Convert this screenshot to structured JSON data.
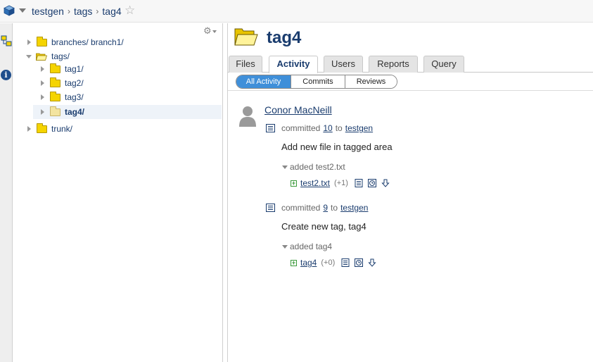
{
  "breadcrumb": {
    "items": [
      "testgen",
      "tags",
      "tag4"
    ],
    "separator": "›"
  },
  "tree": {
    "nodes": [
      {
        "label": "branches/ branch1/",
        "expanded": false
      },
      {
        "label": "tags/",
        "expanded": true
      },
      {
        "label": "tag1/",
        "expanded": false
      },
      {
        "label": "tag2/",
        "expanded": false
      },
      {
        "label": "tag3/",
        "expanded": false
      },
      {
        "label": "tag4/",
        "expanded": false,
        "selected": true
      },
      {
        "label": "trunk/",
        "expanded": false
      }
    ]
  },
  "main": {
    "title": "tag4",
    "tabs": [
      {
        "label": "Files",
        "active": false
      },
      {
        "label": "Activity",
        "active": true
      },
      {
        "label": "Users",
        "active": false
      },
      {
        "label": "Reports",
        "active": false
      },
      {
        "label": "Query",
        "active": false
      }
    ],
    "subtabs": [
      {
        "label": "All Activity",
        "active": true
      },
      {
        "label": "Commits",
        "active": false
      },
      {
        "label": "Reviews",
        "active": false
      }
    ],
    "activity": {
      "author": "Conor MacNeill",
      "commits": [
        {
          "verb": "committed",
          "revision": "10",
          "to": "to",
          "repo": "testgen",
          "message": "Add new file in tagged area",
          "added_label": "added test2.txt",
          "file": {
            "name": "test2.txt",
            "delta": "(+1)"
          }
        },
        {
          "verb": "committed",
          "revision": "9",
          "to": "to",
          "repo": "testgen",
          "message": "Create new tag, tag4",
          "added_label": "added tag4",
          "file": {
            "name": "tag4",
            "delta": "(+0)"
          }
        }
      ]
    }
  },
  "colors": {
    "link": "#1a3c6e",
    "folder": "#f5d400",
    "active_subtab": "#3f8fd9",
    "added_green": "#3a9a3a"
  },
  "icons": {
    "repo": "cube-icon",
    "favorite": "star-icon",
    "settings": "gear-icon",
    "info": "info-icon",
    "changeset": "changeset-icon",
    "view": "view-file-icon",
    "history": "history-icon",
    "download": "download-icon"
  }
}
